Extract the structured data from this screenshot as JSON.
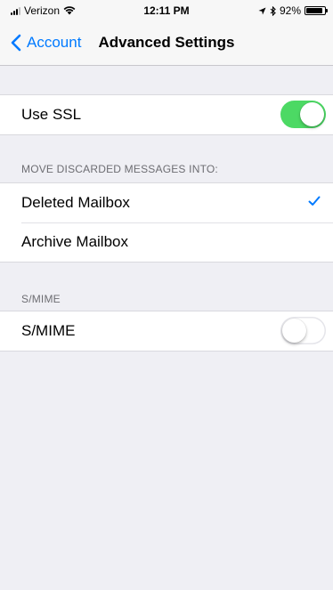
{
  "status_bar": {
    "carrier": "Verizon",
    "time": "12:11 PM",
    "battery_percent": "92%",
    "battery_level": 0.92,
    "icons": [
      "signal-icon",
      "wifi-icon",
      "location-icon",
      "bluetooth-icon",
      "battery-icon"
    ]
  },
  "nav": {
    "back_label": "Account",
    "title": "Advanced Settings"
  },
  "ssl": {
    "label": "Use SSL",
    "enabled": true
  },
  "discarded": {
    "header": "MOVE DISCARDED MESSAGES INTO:",
    "options": [
      {
        "label": "Deleted Mailbox",
        "selected": true
      },
      {
        "label": "Archive Mailbox",
        "selected": false
      }
    ]
  },
  "smime": {
    "header": "S/MIME",
    "label": "S/MIME",
    "enabled": false
  },
  "colors": {
    "accent": "#007aff",
    "toggle_on": "#4cd964",
    "background": "#efeff4"
  }
}
